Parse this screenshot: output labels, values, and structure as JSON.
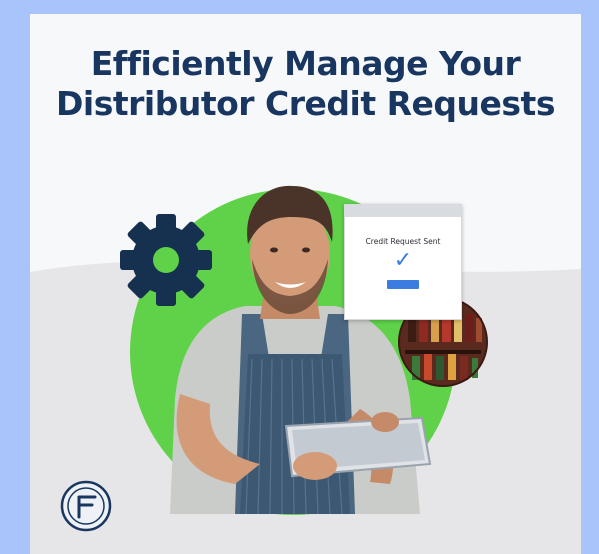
{
  "headline": {
    "line1": "Efficiently Manage Your",
    "line2": "Distributor Credit Requests"
  },
  "dialog": {
    "text": "Credit Request Sent",
    "check_icon": "checkmark-icon"
  },
  "icons": {
    "gear": "gear-icon",
    "logo": "brand-logo-icon"
  },
  "colors": {
    "outer_background": "#a9c4fb",
    "headline": "#18365f",
    "green_circle": "#5fd24a",
    "gear": "#16304f",
    "accent_blue": "#3a7ce0"
  }
}
